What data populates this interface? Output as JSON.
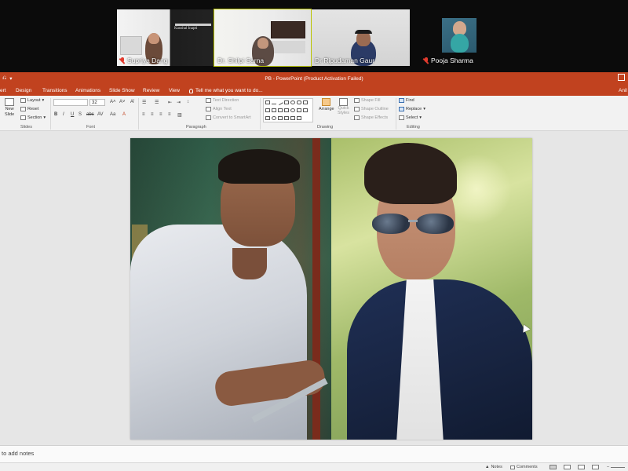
{
  "participants": [
    {
      "name": "Supriya Dang",
      "muted": true
    },
    {
      "name": "Dr. Shilpi Sarna",
      "muted": false
    },
    {
      "name": "Dr Ripudaman Gaur",
      "muted": false
    },
    {
      "name": "Pooja Sharma",
      "muted": true
    }
  ],
  "office_sign": "Kaushal Inapti",
  "titlebar": {
    "title": "PB - PowerPoint (Product Activation Failed)"
  },
  "tabs": [
    "ert",
    "Design",
    "Transitions",
    "Animations",
    "Slide Show",
    "Review",
    "View"
  ],
  "tell_me": "Tell me what you want to do...",
  "account": "Anil",
  "ribbon": {
    "slides": {
      "new_slide": "New",
      "new_slide2": "Slide",
      "layout": "Layout",
      "reset": "Reset",
      "section": "Section",
      "label": "Slides"
    },
    "font": {
      "size": "32",
      "label": "Font"
    },
    "paragraph": {
      "text_direction": "Text Direction",
      "align_text": "Align Text",
      "smartart": "Convert to SmartArt",
      "label": "Paragraph"
    },
    "drawing": {
      "arrange": "Arrange",
      "quick_styles": "Quick",
      "quick_styles2": "Styles",
      "shape_fill": "Shape Fill",
      "shape_outline": "Shape Outline",
      "shape_effects": "Shape Effects",
      "label": "Drawing"
    },
    "editing": {
      "find": "Find",
      "replace": "Replace",
      "select": "Select",
      "label": "Editing"
    }
  },
  "notes_placeholder": "to add notes",
  "status": {
    "notes": "Notes",
    "comments": "Comments"
  },
  "colors": {
    "accent": "#c1421f",
    "video_bg": "#0b0b0b",
    "mute": "#e23b2e"
  }
}
